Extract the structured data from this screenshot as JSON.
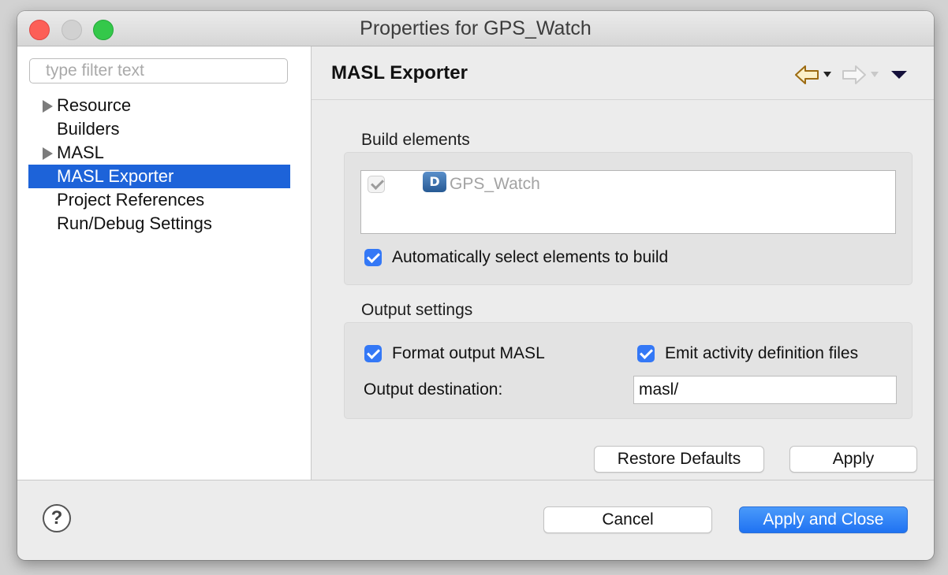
{
  "window": {
    "title": "Properties for GPS_Watch"
  },
  "sidebar": {
    "filter_placeholder": "type filter text",
    "items": [
      {
        "label": "Resource",
        "expandable": true
      },
      {
        "label": "Builders",
        "expandable": false
      },
      {
        "label": "MASL",
        "expandable": true
      },
      {
        "label": "MASL Exporter",
        "expandable": false,
        "selected": true
      },
      {
        "label": "Project References",
        "expandable": false
      },
      {
        "label": "Run/Debug Settings",
        "expandable": false
      }
    ]
  },
  "page": {
    "title": "MASL Exporter",
    "nav": {
      "back_icon": "back-arrow-icon",
      "forward_icon": "forward-arrow-icon",
      "menu_icon": "view-menu-icon"
    },
    "build_elements": {
      "label": "Build elements",
      "items": [
        {
          "name": "GPS_Watch",
          "icon": "D",
          "checked": true,
          "enabled": false
        }
      ],
      "auto_select": {
        "label": "Automatically select elements to build",
        "checked": true
      }
    },
    "output_settings": {
      "label": "Output settings",
      "format_output": {
        "label": "Format output MASL",
        "checked": true
      },
      "emit_activity": {
        "label": "Emit activity definition files",
        "checked": true
      },
      "destination_label": "Output destination:",
      "destination_value": "masl/"
    },
    "buttons": {
      "restore_defaults": "Restore Defaults",
      "apply": "Apply"
    }
  },
  "footer": {
    "help_symbol": "?",
    "cancel": "Cancel",
    "apply_and_close": "Apply and Close"
  },
  "colors": {
    "accent": "#3478f6",
    "selection": "#1d63d9",
    "close": "#fc5f57",
    "maximize": "#34c84a"
  }
}
